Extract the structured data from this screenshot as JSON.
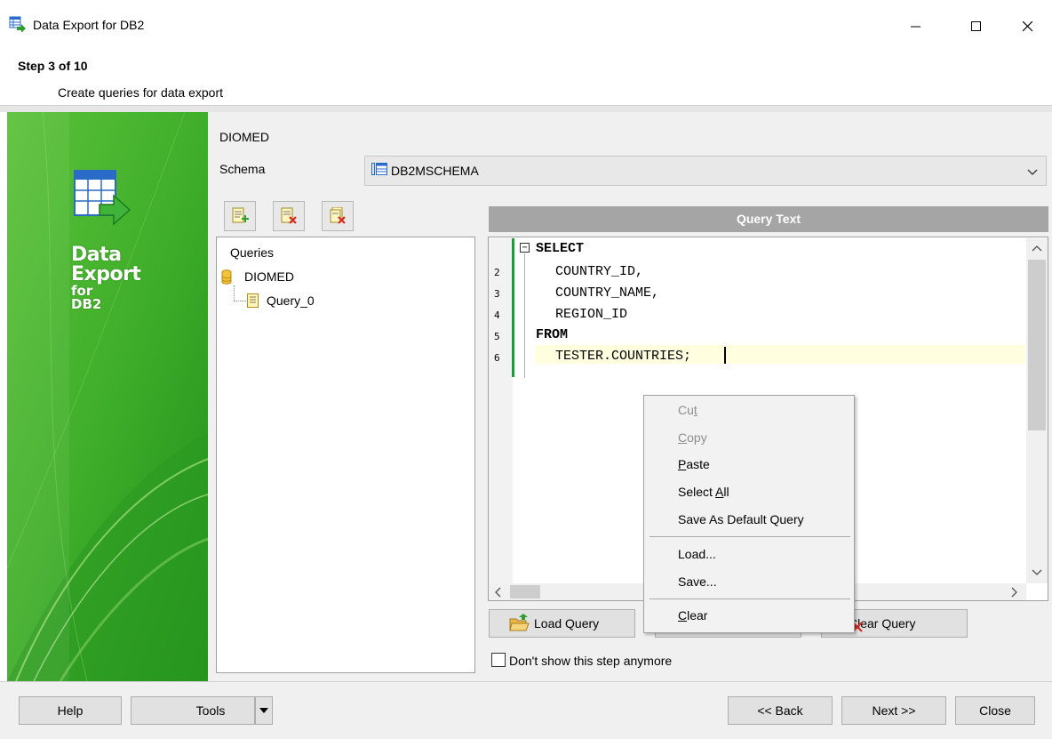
{
  "window": {
    "title": "Data Export for DB2"
  },
  "header": {
    "step": "Step 3 of 10",
    "subtitle": "Create queries for data export"
  },
  "banner": {
    "line1": "Data",
    "line2": "Export",
    "line3": "for",
    "line4": "DB2"
  },
  "database": {
    "name": "DIOMED"
  },
  "schema": {
    "label": "Schema",
    "value": "DB2MSCHEMA"
  },
  "queries": {
    "header": "Queries",
    "db": "DIOMED",
    "items": [
      "Query_0"
    ]
  },
  "editor": {
    "title": "Query Text",
    "line_numbers": [
      "2",
      "3",
      "4",
      "5",
      "6"
    ],
    "lines": [
      "SELECT",
      "  COUNTRY_ID,",
      "  COUNTRY_NAME,",
      "  REGION_ID",
      "FROM",
      "  TESTER.COUNTRIES;"
    ]
  },
  "buttons": {
    "load_query": "Load Query",
    "save_query": "",
    "clear_query": "Clear Query",
    "help": "Help",
    "tools": "Tools",
    "back": "<< Back",
    "next": "Next >>",
    "close": "Close"
  },
  "checkbox": {
    "label": "Don't show this step anymore",
    "checked": false
  },
  "context_menu": {
    "cut": {
      "pre": "Cu",
      "acc": "t",
      "post": ""
    },
    "copy": {
      "pre": "",
      "acc": "C",
      "post": "opy"
    },
    "paste": {
      "pre": "",
      "acc": "P",
      "post": "aste"
    },
    "select_all": {
      "pre": "Select ",
      "acc": "A",
      "post": "ll"
    },
    "save_default": "Save As Default Query",
    "load": "Load...",
    "save": "Save...",
    "clear": {
      "pre": "",
      "acc": "C",
      "post": "lear"
    }
  },
  "colors": {
    "banner_green": "#3fae2a",
    "gutter_green": "#1c9b3b",
    "current_line": "#ffffe0"
  }
}
